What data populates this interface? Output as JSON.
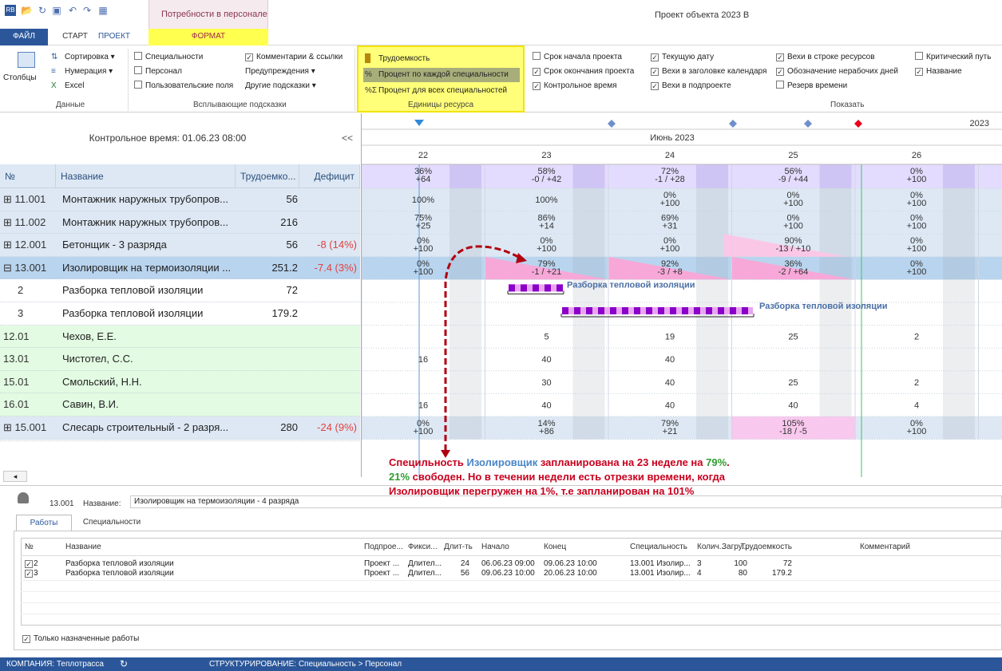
{
  "window_title": "Проект объекта 2023 В",
  "context_tab": "Потребности в персонале",
  "ribbon_tabs": [
    "ФАЙЛ",
    "СТАРТ",
    "ПРОЕКТ",
    "ФОРМАТ"
  ],
  "ribbon": {
    "data": {
      "columns": "Столбцы",
      "sort": "Сортировка",
      "numbering": "Нумерация",
      "excel": "Excel",
      "label": "Данные"
    },
    "tooltips": {
      "specialties": "Специальности",
      "personnel": "Персонал",
      "user_fields": "Пользовательские поля",
      "comments": "Комментарии & ссылки",
      "warnings": "Предупреждения",
      "other": "Другие подсказки",
      "label": "Всплывающие подсказки"
    },
    "units": {
      "labor": "Трудоемкость",
      "pct_each": "Процент по каждой специальности",
      "pct_all": "Процент для всех специальностей",
      "label": "Единицы ресурса"
    },
    "show": {
      "project_start": "Срок начала проекта",
      "project_end": "Срок окончания проекта",
      "control_time": "Контрольное время",
      "current_date": "Текущую дату",
      "milestones_header": "Вехи в заголовке календаря",
      "milestones_sub": "Вехи в подпроекте",
      "milestones_res": "Вехи в строке ресурсов",
      "nonworking": "Обозначение нерабочих дней",
      "reserve": "Резерв времени",
      "critical": "Критический путь",
      "name": "Название",
      "label": "Показать"
    }
  },
  "left_header": {
    "control_time": "Контрольное время: 01.06.23 08:00",
    "collapse": "<<"
  },
  "columns": {
    "num": "№",
    "name": "Название",
    "labor": "Трудоемко...",
    "deficit": "Дефицит"
  },
  "rows": [
    {
      "num": "⊞ 11.001",
      "name": "Монтажник наружных трубопров...",
      "labor": "56",
      "deficit": ""
    },
    {
      "num": "⊞ 11.002",
      "name": "Монтажник наружных трубопров...",
      "labor": "216",
      "deficit": ""
    },
    {
      "num": "⊞ 12.001",
      "name": "Бетонщик - 3 разряда",
      "labor": "56",
      "deficit": "-8 (14%)"
    },
    {
      "num": "⊟ 13.001",
      "name": "Изолировщик на термоизоляции ...",
      "labor": "251.2",
      "deficit": "-7.4 (3%)"
    },
    {
      "num": "2",
      "name": "Разборка тепловой изоляции",
      "labor": "72",
      "deficit": ""
    },
    {
      "num": "3",
      "name": "Разборка тепловой изоляции",
      "labor": "179.2",
      "deficit": ""
    },
    {
      "num": "12.01",
      "name": "Чехов, Е.Е.",
      "labor": "",
      "deficit": ""
    },
    {
      "num": "13.01",
      "name": "Чистотел, С.С.",
      "labor": "",
      "deficit": ""
    },
    {
      "num": "15.01",
      "name": "Смольский, Н.Н.",
      "labor": "",
      "deficit": ""
    },
    {
      "num": "16.01",
      "name": "Савин, В.И.",
      "labor": "",
      "deficit": ""
    },
    {
      "num": "⊞ 15.001",
      "name": "Слесарь строительный - 2 разря...",
      "labor": "280",
      "deficit": "-24 (9%)"
    }
  ],
  "timeline": {
    "year": "2023",
    "month": "Июнь 2023",
    "days": [
      "22",
      "23",
      "24",
      "25",
      "26"
    ]
  },
  "summary_row": [
    [
      "36%",
      "+64"
    ],
    [
      "58%",
      "-0 / +42"
    ],
    [
      "72%",
      "-1 / +28"
    ],
    [
      "56%",
      "-9 / +44"
    ],
    [
      "0%",
      "+100"
    ]
  ],
  "grid_rows": [
    [
      [
        "100%",
        ""
      ],
      [
        "100%",
        ""
      ],
      [
        "0%",
        "+100"
      ],
      [
        "0%",
        "+100"
      ],
      [
        "0%",
        "+100"
      ]
    ],
    [
      [
        "75%",
        "+25"
      ],
      [
        "86%",
        "+14"
      ],
      [
        "69%",
        "+31"
      ],
      [
        "0%",
        "+100"
      ],
      [
        "0%",
        "+100"
      ]
    ],
    [
      [
        "0%",
        "+100"
      ],
      [
        "0%",
        "+100"
      ],
      [
        "0%",
        "+100"
      ],
      [
        "90%",
        "-13 / +10"
      ],
      [
        "0%",
        "+100"
      ]
    ],
    [
      [
        "0%",
        "+100"
      ],
      [
        "79%",
        "-1 / +21"
      ],
      [
        "92%",
        "-3 / +8"
      ],
      [
        "36%",
        "-2 / +64"
      ],
      [
        "0%",
        "+100"
      ]
    ],
    [
      [
        "",
        ""
      ],
      [
        "",
        ""
      ],
      [
        "",
        ""
      ],
      [
        "",
        ""
      ],
      [
        "",
        ""
      ]
    ],
    [
      [
        "",
        ""
      ],
      [
        "",
        ""
      ],
      [
        "",
        ""
      ],
      [
        "",
        ""
      ],
      [
        "",
        ""
      ]
    ],
    [
      [
        "",
        ""
      ],
      [
        "5",
        ""
      ],
      [
        "19",
        ""
      ],
      [
        "25",
        ""
      ],
      [
        "2",
        ""
      ]
    ],
    [
      [
        "16",
        ""
      ],
      [
        "40",
        ""
      ],
      [
        "40",
        ""
      ],
      [
        "",
        ""
      ],
      [
        "",
        ""
      ]
    ],
    [
      [
        "",
        ""
      ],
      [
        "30",
        ""
      ],
      [
        "40",
        ""
      ],
      [
        "25",
        ""
      ],
      [
        "2",
        ""
      ]
    ],
    [
      [
        "16",
        ""
      ],
      [
        "40",
        ""
      ],
      [
        "40",
        ""
      ],
      [
        "40",
        ""
      ],
      [
        "4",
        ""
      ]
    ],
    [
      [
        "0%",
        "+100"
      ],
      [
        "14%",
        "+86"
      ],
      [
        "79%",
        "+21"
      ],
      [
        "105%",
        "-18 / -5"
      ],
      [
        "0%",
        "+100"
      ]
    ]
  ],
  "bars": {
    "bar1": "Разборка тепловой изоляции",
    "bar2": "Разборка тепловой изоляции"
  },
  "annotation": {
    "l1a": "Специльность ",
    "l1b": "Изолировщик",
    "l1c": " запланирована на 23 неделе на ",
    "l1d": "79%",
    "l1e": ".",
    "l2a": "21%",
    "l2b": " свободен. Но в течении недели есть отрезки времени, когда",
    "l3": "Изолировщик перегружен на 1%, т.е запланирован на 101%"
  },
  "detail": {
    "id": "13.001",
    "name_label": "Название:",
    "name_value": "Изолировщик на термоизоляции - 4 разряда",
    "tabs": [
      "Работы",
      "Специальности"
    ]
  },
  "works_table": {
    "headers": [
      "№",
      "Название",
      "Подпрое...",
      "Фикси...",
      "Длит-ть",
      "Начало",
      "Конец",
      "Специальность",
      "Колич...",
      "Загру...",
      "Трудоемкость",
      "Комментарий"
    ],
    "rows": [
      [
        "2",
        "Разборка тепловой изоляции",
        "Проект ...",
        "Длител...",
        "24",
        "06.06.23 09:00",
        "09.06.23 10:00",
        "13.001 Изолир...",
        "3",
        "100",
        "72",
        ""
      ],
      [
        "3",
        "Разборка тепловой изоляции",
        "Проект ...",
        "Длител...",
        "56",
        "09.06.23 10:00",
        "20.06.23 10:00",
        "13.001 Изолир...",
        "4",
        "80",
        "179.2",
        ""
      ]
    ]
  },
  "only_assigned": "Только назначенные работы",
  "status": {
    "company": "КОМПАНИЯ: Теплотрасса",
    "structure": "СТРУКТУРИРОВАНИЕ: Специальность > Персонал"
  },
  "colors": {
    "accent": "#2b579a",
    "highlight": "#ffff79",
    "annotation_red": "#c8001e",
    "annotation_blue": "#4a86c8",
    "annotation_green": "#2f9c2f"
  }
}
